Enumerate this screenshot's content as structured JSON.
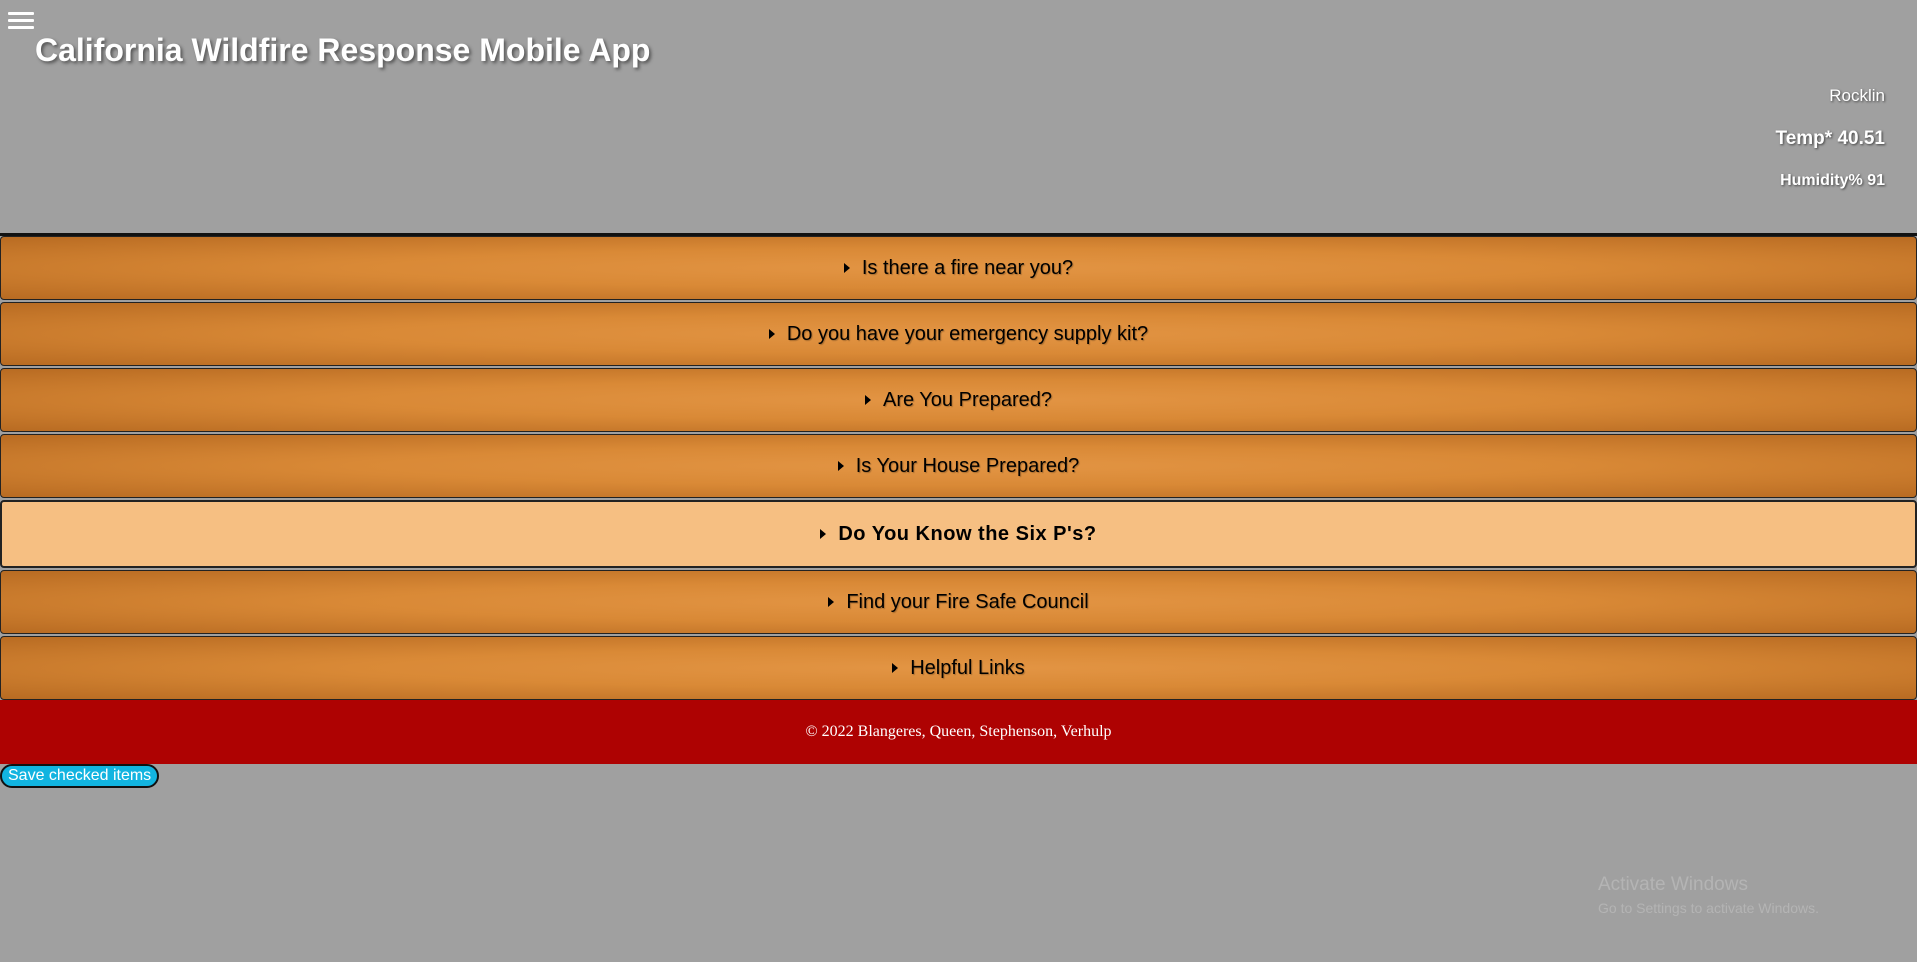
{
  "header": {
    "title": "California Wildfire Response Mobile App",
    "menu_icon": "hamburger-menu-icon"
  },
  "weather": {
    "city": "Rocklin",
    "temp": "Temp* 40.51",
    "humidity": "Humidity% 91"
  },
  "accordion": [
    {
      "label": "Is there a fire near you?"
    },
    {
      "label": "Do you have your emergency supply kit?"
    },
    {
      "label": "Are You Prepared?"
    },
    {
      "label": "Is Your House Prepared?"
    },
    {
      "label": "Do You Know the Six P's?"
    },
    {
      "label": "Find your Fire Safe Council"
    },
    {
      "label": "Helpful Links"
    }
  ],
  "active_index": 4,
  "footer": {
    "copyright": "© 2022 Blangeres, Queen, Stephenson, Verhulp"
  },
  "actions": {
    "save_label": "Save checked items"
  },
  "watermark": {
    "title": "Activate Windows",
    "subtitle": "Go to Settings to activate Windows."
  },
  "colors": {
    "accordion_bg": "#d98936",
    "accordion_active_bg": "#f6bf82",
    "footer_bg": "#ae0202",
    "save_button_bg": "#12b4e0",
    "page_bg": "#a0a0a0"
  }
}
